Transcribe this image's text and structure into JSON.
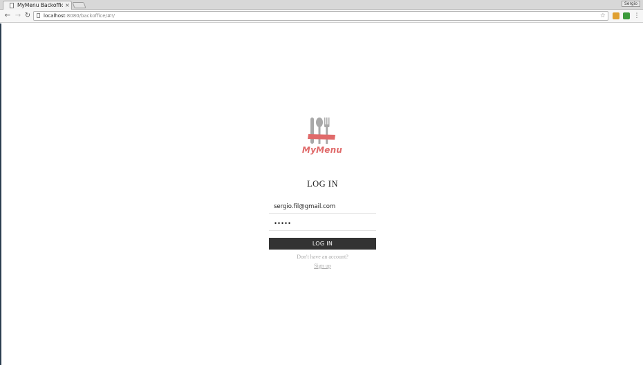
{
  "browser": {
    "tab_title": "MyMenu Backoffice",
    "tab_close": "×",
    "profile_label": "Sergio",
    "url_host": "localhost",
    "url_path": ":8080/backoffice/#!/",
    "icons": [
      "back-icon",
      "forward-icon",
      "reload-icon",
      "star-icon",
      "menu-icon"
    ]
  },
  "login": {
    "brand": "MyMenu",
    "title": "LOG IN",
    "email_value": "sergio.fil@gmail.com",
    "password_value": "•••••",
    "button_label": "LOG IN",
    "no_account_text": "Don't have an account?",
    "signup_label": "Sign up"
  },
  "colors": {
    "brand": "#e06a6a",
    "button_bg": "#333333",
    "muted_text": "#aaaaaa"
  }
}
